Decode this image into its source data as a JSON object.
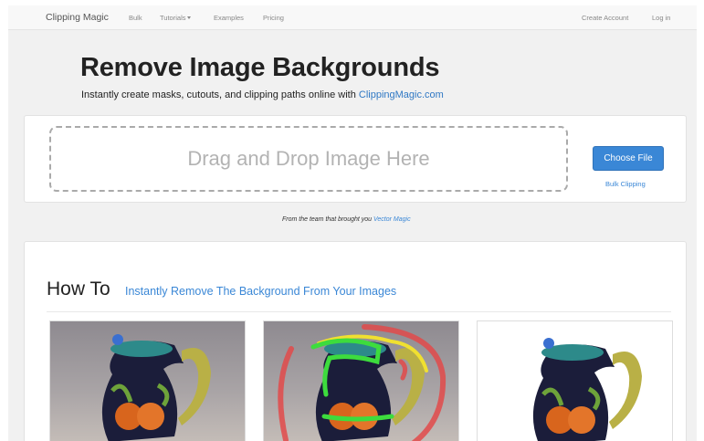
{
  "navbar": {
    "brand": "Clipping Magic",
    "links": {
      "bulk": "Bulk",
      "tutorials": "Tutorials",
      "examples": "Examples",
      "pricing": "Pricing",
      "create_account": "Create Account",
      "login": "Log in"
    }
  },
  "hero": {
    "title": "Remove Image Backgrounds",
    "subtitle": "Instantly create masks, cutouts, and clipping paths online with ",
    "subtitle_link": "ClippingMagic.com"
  },
  "upload": {
    "drop_text": "Drag and Drop Image Here",
    "choose_button": "Choose File",
    "bulk_link": "Bulk Clipping"
  },
  "team": {
    "text": "From the team that brought you ",
    "link": "Vector Magic"
  },
  "howto": {
    "title": "How To",
    "subtitle": "Instantly Remove The Background From Your Images"
  },
  "colors": {
    "accent": "#3a87d6",
    "link": "#2f78c4",
    "markup_red": "#e24a4a",
    "markup_green": "#3ddc3d",
    "markup_yellow": "#f0e030"
  }
}
